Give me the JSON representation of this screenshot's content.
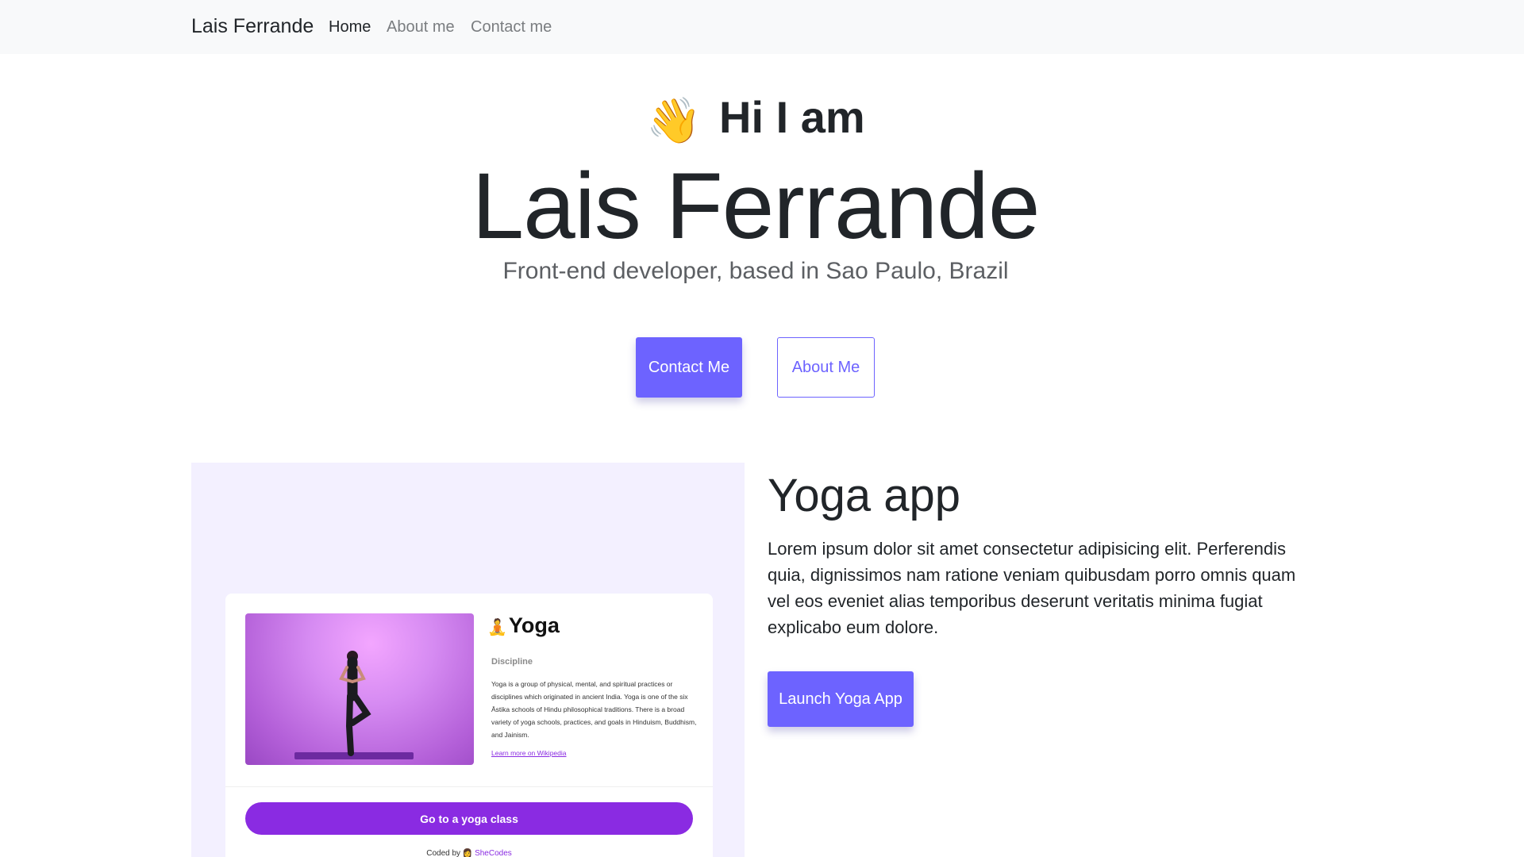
{
  "navbar": {
    "brand": "Lais Ferrande",
    "items": [
      {
        "label": "Home",
        "active": true
      },
      {
        "label": "About me",
        "active": false
      },
      {
        "label": "Contact me",
        "active": false
      }
    ]
  },
  "hero": {
    "greeting": "Hi I am",
    "wave_icon": "👋",
    "name": "Lais Ferrande",
    "subtitle": "Front-end developer, based in Sao Paulo, Brazil",
    "contact_button": "Contact Me",
    "about_button": "About Me"
  },
  "project": {
    "title": "Yoga app",
    "description": "Lorem ipsum dolor sit amet consectetur adipisicing elit. Perferendis quia, dignissimos nam ratione veniam quibusdam porro omnis quam vel eos eveniet alias temporibus deserunt veritatis minima fugiat explicabo eum dolore.",
    "launch_button": "Launch Yoga App",
    "preview": {
      "title": "Yoga",
      "title_icon": "🧘",
      "discipline_label": "Discipline",
      "description": "Yoga is a group of physical, mental, and spiritual practices or disciplines which originated in ancient India. Yoga is one of the six Āstika schools of Hindu philosophical traditions. There is a broad variety of yoga schools, practices, and goals in Hinduism, Buddhism, and Jainism.",
      "link": "Learn more on Wikipedia",
      "cta": "Go to a yoga class",
      "footer_prefix": "Coded by",
      "footer_icon": "👩",
      "footer_link": "SheCodes"
    }
  },
  "colors": {
    "accent": "#6d63ff",
    "preview_accent": "#8a2be2",
    "navbar_bg": "#f8f9fa",
    "project_frame_bg": "#f3f0ff"
  }
}
